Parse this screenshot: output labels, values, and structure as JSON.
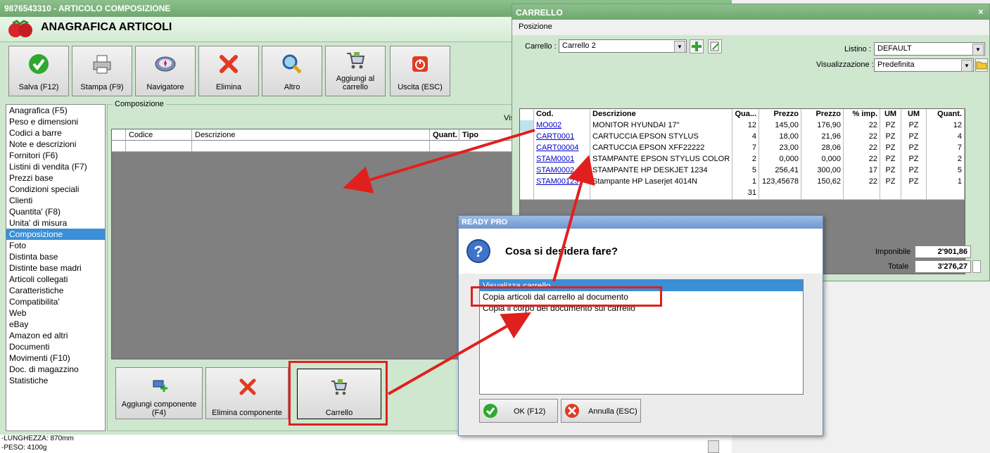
{
  "main_window": {
    "title": "9876543310 - ARTICOLO COMPOSIZIONE",
    "header": "ANAGRAFICA ARTICOLI",
    "toolbar": [
      {
        "label": "Salva (F12)",
        "icon": "check-icon"
      },
      {
        "label": "Stampa (F9)",
        "icon": "printer-icon"
      },
      {
        "label": "Navigatore",
        "icon": "compass-icon"
      },
      {
        "label": "Elimina",
        "icon": "delete-x-icon"
      },
      {
        "label": "Altro",
        "icon": "magnifier-icon"
      },
      {
        "label": "Aggiungi al carrello",
        "icon": "cart-icon"
      },
      {
        "label": "Uscita (ESC)",
        "icon": "power-icon"
      }
    ],
    "nav_items": [
      "Anagrafica (F5)",
      "Peso e dimensioni",
      "Codici a barre",
      "Note e descrizioni",
      "Fornitori (F6)",
      "Listini di vendita (F7)",
      "Prezzi base",
      "Condizioni speciali",
      "Clienti",
      "Quantita' (F8)",
      "Unita' di misura",
      "Composizione",
      "Foto",
      "Distinta base",
      "Distinte base madri",
      "Articoli collegati",
      "Caratteristiche",
      "Compatibilita'",
      "Web",
      "eBay",
      "Amazon ed altri",
      "Documenti",
      "Movimenti (F10)",
      "Doc. di magazzino",
      "Statistiche"
    ],
    "nav_selected": "Composizione",
    "composizione": {
      "group_label": "Composizione",
      "vis_label": "Vis",
      "columns": [
        "Codice",
        "Descrizione",
        "Quant.",
        "Tipo"
      ]
    },
    "bottom_buttons": [
      {
        "label": "Aggiungi componente (F4)",
        "icon": "add-component-icon"
      },
      {
        "label": "Elimina componente",
        "icon": "delete-x-icon"
      },
      {
        "label": "Carrello",
        "icon": "cart-icon"
      }
    ],
    "status_lines": [
      "-LUNGHEZZA: 870mm",
      "-PESO: 4100g"
    ]
  },
  "cart_window": {
    "title": "CARRELLO",
    "menu": "Posizione",
    "carrello_label": "Carrello :",
    "carrello_value": "Carrello 2",
    "listino_label": "Listino :",
    "listino_value": "DEFAULT",
    "visualizzazione_label": "Visualizzazione :",
    "visualizzazione_value": "Predefinita",
    "columns": [
      "Cod.",
      "Descrizione",
      "Qua...",
      "Prezzo",
      "Prezzo",
      "% imp.",
      "UM",
      "UM",
      "Quant."
    ],
    "rows": [
      {
        "cod": "MO002",
        "descr": "MONITOR HYUNDAI 17\"",
        "qta": "12",
        "prezzo": "145,00",
        "prezzo2": "176,90",
        "imp": "22",
        "um": "PZ",
        "um2": "PZ",
        "quant": "12"
      },
      {
        "cod": "CART0001",
        "descr": "CARTUCCIA EPSON STYLUS",
        "qta": "4",
        "prezzo": "18,00",
        "prezzo2": "21,96",
        "imp": "22",
        "um": "PZ",
        "um2": "PZ",
        "quant": "4"
      },
      {
        "cod": "CART00004",
        "descr": "CARTUCCIA EPSON XFF22222",
        "qta": "7",
        "prezzo": "23,00",
        "prezzo2": "28,06",
        "imp": "22",
        "um": "PZ",
        "um2": "PZ",
        "quant": "7"
      },
      {
        "cod": "STAM0001",
        "descr": "STAMPANTE EPSON STYLUS COLOR C...",
        "qta": "2",
        "prezzo": "0,000",
        "prezzo2": "0,000",
        "imp": "22",
        "um": "PZ",
        "um2": "PZ",
        "quant": "2"
      },
      {
        "cod": "STAM0002",
        "descr": "STAMPANTE HP DESKJET 1234",
        "qta": "5",
        "prezzo": "256,41",
        "prezzo2": "300,00",
        "imp": "17",
        "um": "PZ",
        "um2": "PZ",
        "quant": "5"
      },
      {
        "cod": "STAM00123",
        "descr": "Stampante HP Laserjet 4014N",
        "qta": "1",
        "prezzo": "123,45678",
        "prezzo2": "150,62",
        "imp": "22",
        "um": "PZ",
        "um2": "PZ",
        "quant": "1"
      }
    ],
    "total_qty": "31",
    "imponibile_label": "Imponibile",
    "imponibile_value": "2'901,86",
    "totale_label": "Totale",
    "totale_value": "3'276,27"
  },
  "dialog": {
    "title": "READY PRO",
    "question": "Cosa si desidera fare?",
    "options": [
      "Visualizza carrello",
      "Copia articoli dal carrello al documento",
      "Copia il corpo del documento sul carrello"
    ],
    "selected_option": "Visualizza carrello",
    "ok_label": "OK (F12)",
    "cancel_label": "Annulla (ESC)"
  },
  "colors": {
    "accent": "#3a8fd6",
    "highlight": "#e0201e",
    "window_green": "#cfe6cf",
    "title_green": "#7fb57f"
  }
}
